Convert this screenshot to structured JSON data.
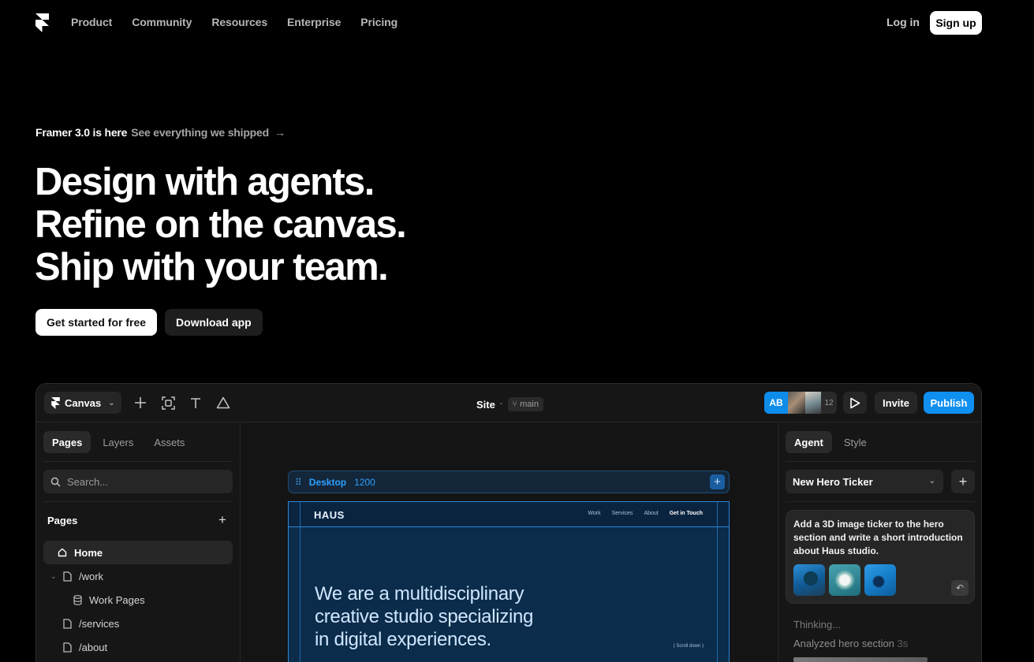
{
  "nav": {
    "links": [
      "Product",
      "Community",
      "Resources",
      "Enterprise",
      "Pricing"
    ],
    "login": "Log in",
    "signup": "Sign up"
  },
  "hero": {
    "announce_strong": "Framer 3.0 is here",
    "announce_link": "See everything we shipped",
    "headline": [
      "Design with agents.",
      "Refine on the canvas.",
      "Ship with your team."
    ],
    "cta_primary": "Get started for free",
    "cta_secondary": "Download app"
  },
  "app": {
    "toolbar": {
      "canvas_label": "Canvas",
      "site_title": "Site",
      "separator": "·",
      "branch": "main",
      "avatar_initials": "AB",
      "collaborator_count": "12",
      "invite": "Invite",
      "publish": "Publish"
    },
    "left": {
      "tabs": [
        "Pages",
        "Layers",
        "Assets"
      ],
      "search_placeholder": "Search...",
      "pages_heading": "Pages",
      "pages": [
        {
          "label": "Home",
          "icon": "home-icon",
          "active": true
        },
        {
          "label": "/work",
          "icon": "page-icon",
          "collapsible": true
        },
        {
          "label": "Work Pages",
          "icon": "database-icon",
          "indent": true
        },
        {
          "label": "/services",
          "icon": "page-icon"
        },
        {
          "label": "/about",
          "icon": "page-icon"
        }
      ]
    },
    "canvas": {
      "frame_name": "Desktop",
      "frame_width": "1200",
      "site_logo": "HAUS",
      "site_nav": [
        "Work",
        "Services",
        "About",
        "Get in Touch"
      ],
      "site_hero": [
        "We are a multidisciplinary",
        "creative studio specializing",
        "in digital experiences."
      ],
      "scroll_hint": "( Scroll down )"
    },
    "right": {
      "tabs": [
        "Agent",
        "Style"
      ],
      "selected_chat": "New Hero Ticker",
      "prompt": "Add a 3D image ticker to the hero section and write a short introduction about Haus studio.",
      "status_thinking": "Thinking...",
      "status_analyzed": "Analyzed hero section",
      "status_duration": "3s"
    }
  },
  "colors": {
    "background": "#000000",
    "accent_blue": "#0f8ff0",
    "canvas_frame": "#0b2c4a"
  }
}
